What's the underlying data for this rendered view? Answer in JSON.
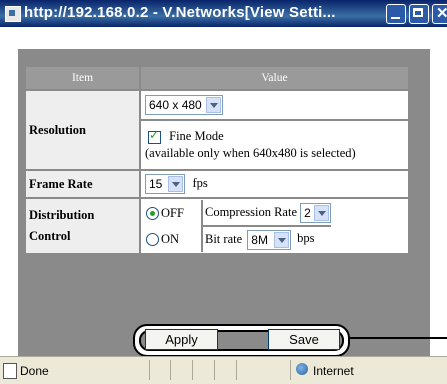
{
  "window": {
    "title": "http://192.168.0.2 - V.Networks[View Setti..."
  },
  "table": {
    "col_item": "Item",
    "col_value": "Value",
    "resolution": {
      "label": "Resolution",
      "selected": "640 x 480",
      "fine_mode_label": "Fine Mode",
      "fine_mode_checked": true,
      "note": "(available only when 640x480 is selected)"
    },
    "frame_rate": {
      "label": "Frame Rate",
      "selected": "15",
      "unit": "fps"
    },
    "distribution": {
      "label_line1": "Distribution",
      "label_line2": "Control",
      "option_off": "OFF",
      "option_on": "ON",
      "selected_option": "OFF",
      "compression_label": "Compression Rate",
      "compression_value": "2",
      "bitrate_label": "Bit rate",
      "bitrate_value": "8M",
      "bitrate_unit": "bps"
    }
  },
  "buttons": {
    "apply": "Apply",
    "save": "Save"
  },
  "statusbar": {
    "status": "Done",
    "zone": "Internet"
  }
}
